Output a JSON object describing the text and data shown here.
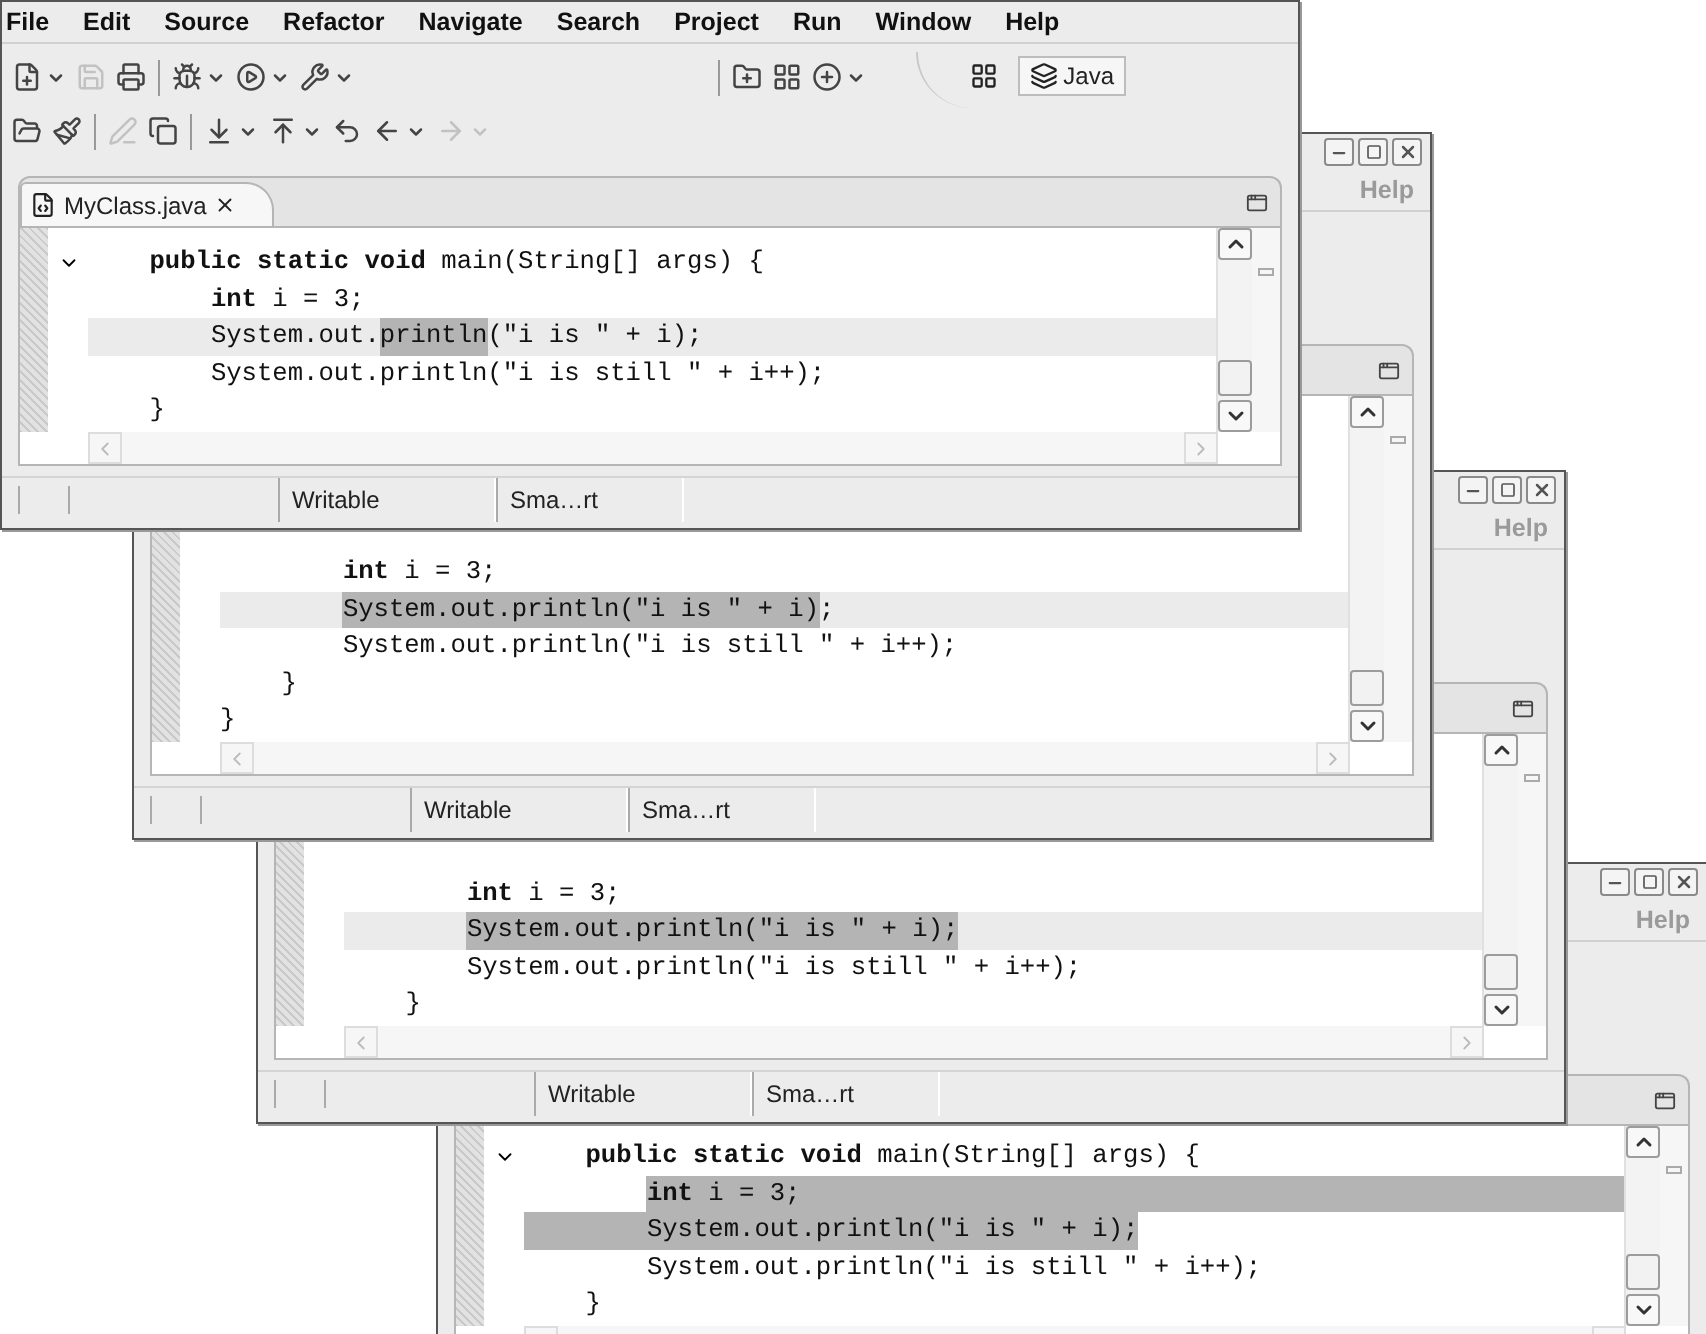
{
  "windows": [
    {
      "kind": "front",
      "menu": [
        "File",
        "Edit",
        "Source",
        "Refactor",
        "Navigate",
        "Search",
        "Project",
        "Run",
        "Window",
        "Help"
      ],
      "toolbar": [
        [
          {
            "kind": "dropdown",
            "disabled": false
          },
          {
            "kind": "button",
            "disabled": true
          },
          {
            "kind": "button",
            "disabled": false
          },
          {
            "kind": "separator"
          },
          {
            "kind": "dropdown",
            "disabled": false
          },
          {
            "kind": "dropdown",
            "disabled": false
          },
          {
            "kind": "dropdown",
            "disabled": false
          },
          {
            "kind": "separator"
          },
          {
            "kind": "button",
            "disabled": false
          },
          {
            "kind": "button",
            "disabled": false
          },
          {
            "kind": "dropdown",
            "disabled": false
          }
        ],
        [
          {
            "kind": "button",
            "disabled": false
          },
          {
            "kind": "button",
            "disabled": false
          },
          {
            "kind": "separator"
          },
          {
            "kind": "button",
            "disabled": true
          },
          {
            "kind": "button",
            "disabled": false
          },
          {
            "kind": "separator"
          },
          {
            "kind": "dropdown",
            "disabled": false
          },
          {
            "kind": "dropdown",
            "disabled": false
          },
          {
            "kind": "button",
            "disabled": false
          },
          {
            "kind": "dropdown",
            "disabled": false
          },
          {
            "kind": "dropdown",
            "disabled": true
          }
        ]
      ],
      "perspective": {
        "label": "Java",
        "selected": true
      },
      "tab": {
        "label": "MyClass.java",
        "selected": true
      },
      "lines": [
        {
          "segments": [
            {
              "text": "    **public** **static** **void** main(String[] args) {",
              "selected": false
            }
          ],
          "current": false,
          "selected_from_start": false,
          "selected_to_end": false,
          "expanded": true
        },
        {
          "segments": [
            {
              "text": "        **int** i = 3;",
              "selected": false
            }
          ],
          "current": false,
          "selected_from_start": false,
          "selected_to_end": false
        },
        {
          "segments": [
            {
              "text": "        System.out.",
              "selected": false
            },
            {
              "text": "println",
              "selected": true
            },
            {
              "text": "(\"i is \" + i);",
              "selected": false
            }
          ],
          "current": true,
          "selected_from_start": false,
          "selected_to_end": false
        },
        {
          "segments": [
            {
              "text": "        System.out.println(\"i is still \" + i++);",
              "selected": false
            }
          ],
          "current": false,
          "selected_from_start": false,
          "selected_to_end": false
        },
        {
          "segments": [
            {
              "text": "    }",
              "selected": false
            }
          ],
          "current": false,
          "selected_from_start": false,
          "selected_to_end": false
        }
      ],
      "status": [
        "Writable",
        "Sma…rt"
      ]
    },
    {
      "kind": "back",
      "menu": [
        "Help"
      ],
      "lines": [
        {
          "segments": [
            {
              "text": "        **int** i = 3;",
              "selected": false
            }
          ],
          "current": false,
          "selected_from_start": false,
          "selected_to_end": false
        },
        {
          "segments": [
            {
              "text": "        System.out.println(\"i is \" + i)",
              "selected": true
            },
            {
              "text": ";",
              "selected": false
            }
          ],
          "current": true,
          "selected_from_start": false,
          "selected_to_end": false
        },
        {
          "segments": [
            {
              "text": "        System.out.println(\"i is still \" + i++);",
              "selected": false
            }
          ],
          "current": false,
          "selected_from_start": false,
          "selected_to_end": false
        },
        {
          "segments": [
            {
              "text": "    }",
              "selected": false
            }
          ],
          "current": false,
          "selected_from_start": false,
          "selected_to_end": false
        },
        {
          "segments": [
            {
              "text": "}",
              "selected": false
            }
          ],
          "current": false,
          "selected_to_end": false
        }
      ],
      "status": [
        "Writable",
        "Sma…rt"
      ]
    },
    {
      "kind": "back",
      "menu": [
        "Help"
      ],
      "lines": [
        {
          "segments": [
            {
              "text": "        **int** i = 3;",
              "selected": false
            }
          ],
          "current": false,
          "selected_from_start": false,
          "selected_to_end": false
        },
        {
          "segments": [
            {
              "text": "        System.out.println(\"i is \" + i);",
              "selected": true
            }
          ],
          "current": true,
          "selected_from_start": false,
          "selected_to_end": false
        },
        {
          "segments": [
            {
              "text": "        System.out.println(\"i is still \" + i++);",
              "selected": false
            }
          ],
          "current": false,
          "selected_from_start": false,
          "selected_to_end": false
        },
        {
          "segments": [
            {
              "text": "    }",
              "selected": false
            }
          ],
          "current": false,
          "selected_from_start": false,
          "selected_to_end": false
        }
      ],
      "status": [
        "Writable",
        "Sma…rt"
      ]
    },
    {
      "kind": "back",
      "menu": [
        "Help"
      ],
      "lines": [
        {
          "segments": [
            {
              "text": "    **public** **static** **void** main(String[] args) {",
              "selected": false
            }
          ],
          "current": false,
          "selected_from_start": false,
          "selected_to_end": false,
          "expanded": true
        },
        {
          "segments": [
            {
              "text": "        **int** i = 3;",
              "selected": true
            }
          ],
          "current": false,
          "selected_from_start": false,
          "selected_to_end": true
        },
        {
          "segments": [
            {
              "text": "        System.out.println(\"i is \" + i);",
              "selected": true
            }
          ],
          "current": false,
          "selected_from_start": true,
          "selected_to_end": false
        },
        {
          "segments": [
            {
              "text": "        System.out.println(\"i is still \" + i++);",
              "selected": false
            }
          ],
          "current": false,
          "selected_from_start": false,
          "selected_to_end": false
        },
        {
          "segments": [
            {
              "text": "    }",
              "selected": false
            }
          ],
          "current": false,
          "selected_from_start": false,
          "selected_to_end": false
        }
      ]
    }
  ]
}
